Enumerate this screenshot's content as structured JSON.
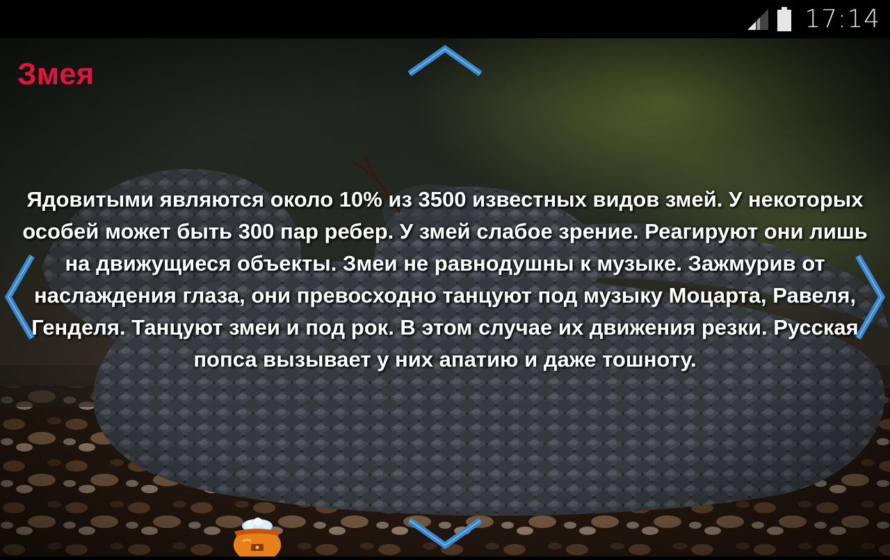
{
  "status_bar": {
    "time": "17:14",
    "signal_icon": "signal-icon",
    "battery_icon": "battery-icon"
  },
  "article": {
    "title": "Змея",
    "text": "Ядовитыми являются около 10% из 3500 известных видов змей. У некоторых особей может быть 300 пар ребер. У змей слабое зрение. Реагируют они лишь на движущиеся объекты. Змеи не равнодушны к музыке. Зажмурив от наслаждения глаза, они превосходно танцуют под музыку Моцарта,  Равеля, Генделя. Танцуют змеи и под рок. В этом случае их движения резки. Русская попса вызывает у них апатию и даже тошноту."
  },
  "navigation": {
    "up_icon": "chevron-up-icon",
    "down_icon": "chevron-down-icon",
    "left_icon": "chevron-left-icon",
    "right_icon": "chevron-right-icon",
    "accent_color": "#3a86c8"
  },
  "colors": {
    "title": "#e0143c",
    "text": "#ffffff",
    "status_bar": "#000000"
  },
  "decor": {
    "pot_icon": "treasure-pot-icon"
  }
}
